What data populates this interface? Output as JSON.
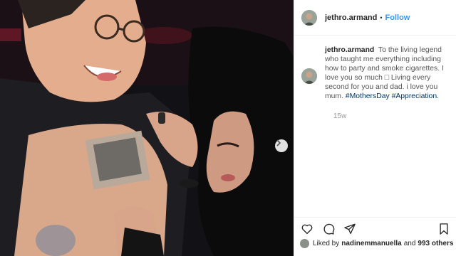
{
  "post": {
    "username": "jethro.armand",
    "dot": "•",
    "follow_label": "Follow",
    "caption_user": "jethro.armand",
    "caption_text": "To the living legend who taught me everything including how to party and smoke cigarettes. I love you so much □ Living every second for you and dad. i love you mum.",
    "hashtag_1": "#MothersDay",
    "hashtag_2": "#Appreciation.",
    "time_ago": "15w",
    "liked_by_prefix": "Liked by",
    "liked_by_user": "nadinemmanuella",
    "liked_by_and": "and",
    "liked_by_count": "993 others"
  },
  "icons": {
    "like": "heart-icon",
    "comment": "comment-icon",
    "share": "share-icon",
    "save": "bookmark-icon",
    "next": "chevron-right-icon"
  },
  "colors": {
    "follow": "#3897f0",
    "hashtag": "#003569",
    "photo_bg": "#0d0d10"
  }
}
